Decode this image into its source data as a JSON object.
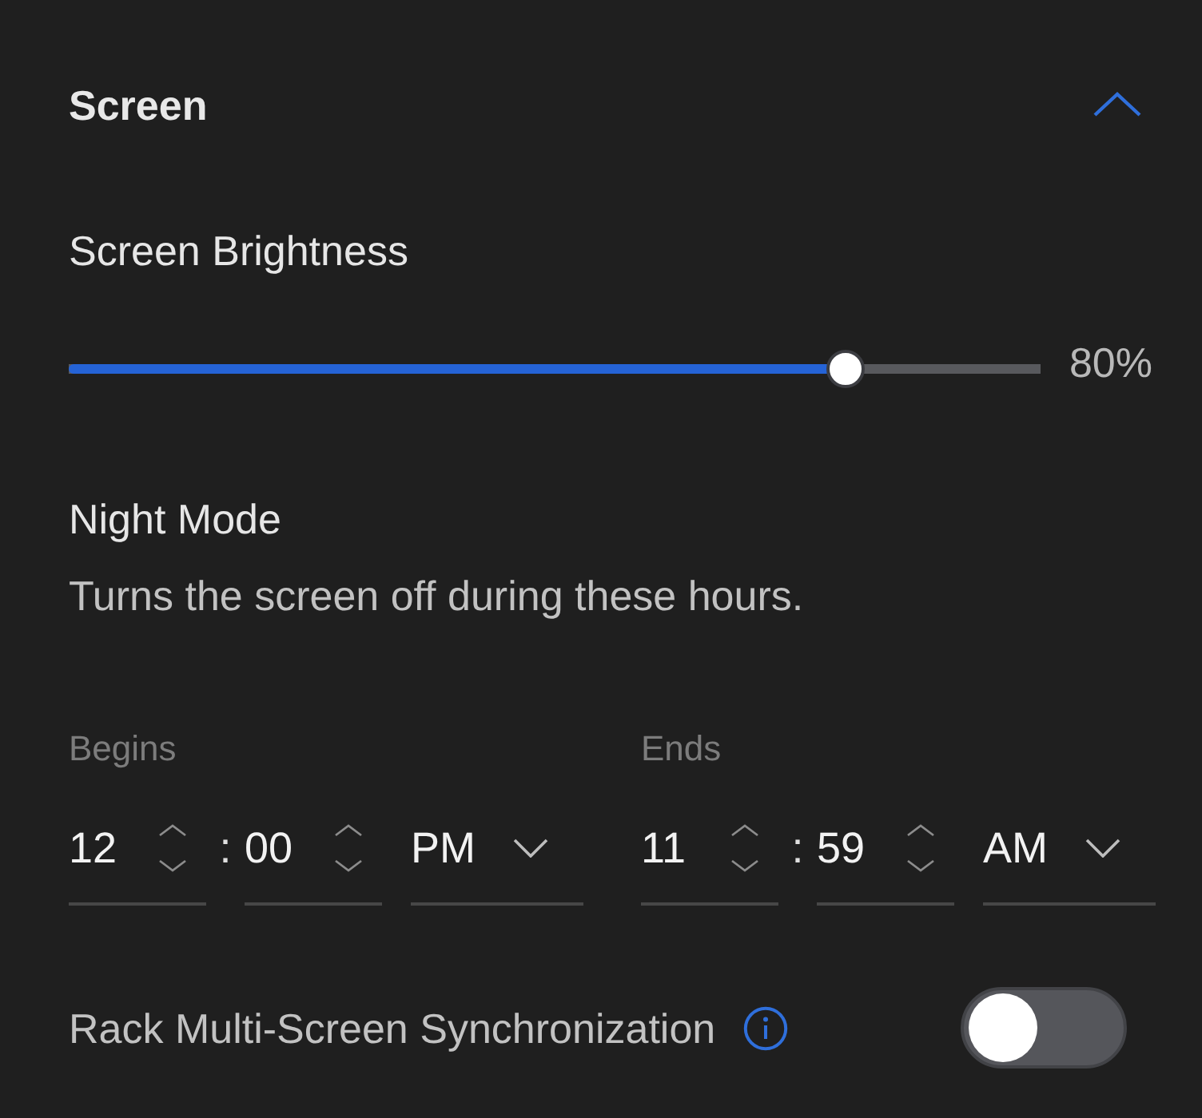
{
  "section": {
    "title": "Screen",
    "expanded": true
  },
  "brightness": {
    "label": "Screen Brightness",
    "level": 0.8,
    "reading": "80%"
  },
  "night_mode": {
    "title": "Night Mode",
    "description": "Turns the screen off during these hours.",
    "ranges": [
      {
        "label": "Begins",
        "hour": "12",
        "separator": ":",
        "minute": "00",
        "period": "PM"
      },
      {
        "label": "Ends",
        "hour": "11",
        "separator": ":",
        "minute": "59",
        "period": "AM"
      }
    ]
  },
  "sync": {
    "label": "Rack Multi-Screen Synchronization",
    "on": false
  }
}
